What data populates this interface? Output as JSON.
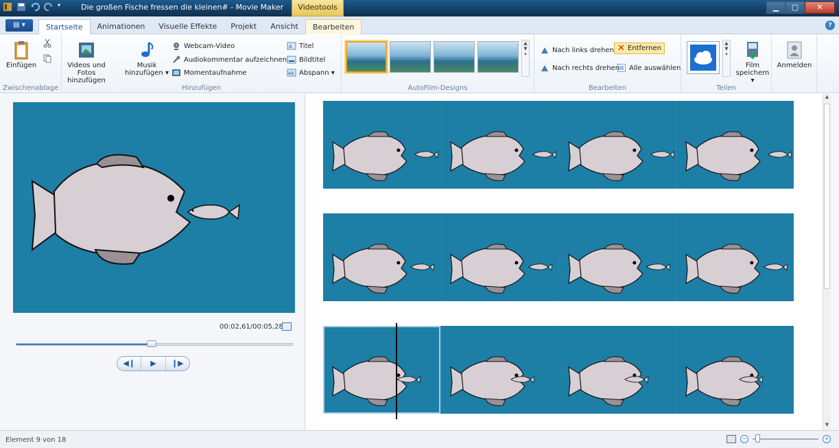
{
  "window": {
    "title": "Die großen Fische fressen die kleinen# - Movie Maker",
    "context_tab_group": "Videotools"
  },
  "tabs": [
    {
      "label": "Startseite",
      "active": true
    },
    {
      "label": "Animationen"
    },
    {
      "label": "Visuelle Effekte"
    },
    {
      "label": "Projekt"
    },
    {
      "label": "Ansicht"
    },
    {
      "label": "Bearbeiten",
      "contextual": true
    }
  ],
  "ribbon": {
    "clipboard": {
      "label": "Zwischenablage",
      "paste": "Einfügen"
    },
    "add": {
      "label": "Hinzufügen",
      "videos_photos_l1": "Videos und Fotos",
      "videos_photos_l2": "hinzufügen",
      "music_l1": "Musik",
      "music_l2": "hinzufügen ▾",
      "webcam": "Webcam-Video",
      "narration": "Audiokommentar aufzeichnen ▾",
      "snapshot": "Momentaufnahme",
      "title": "Titel",
      "caption": "Bildtitel",
      "credits": "Abspann ▾"
    },
    "themes": {
      "label": "AutoFilm-Designs"
    },
    "edit": {
      "label": "Bearbeiten",
      "rotate_left": "Nach links drehen",
      "rotate_right": "Nach rechts drehen",
      "remove": "Entfernen",
      "select_all": "Alle auswählen"
    },
    "share": {
      "label": "Teilen",
      "save_movie_l1": "Film",
      "save_movie_l2": "speichern ▾"
    },
    "signin": "Anmelden"
  },
  "preview": {
    "timecode": "00:02,61/00:05,28",
    "seek_fraction": 0.49,
    "controls": {
      "prev": "◀❙",
      "play": "▶",
      "next": "❙▶"
    }
  },
  "status": {
    "text": "Element 9 von 18"
  },
  "colors": {
    "accent": "#3a7dc8",
    "video_bg": "#1c7aa3",
    "context_tab": "#e6c75a"
  }
}
